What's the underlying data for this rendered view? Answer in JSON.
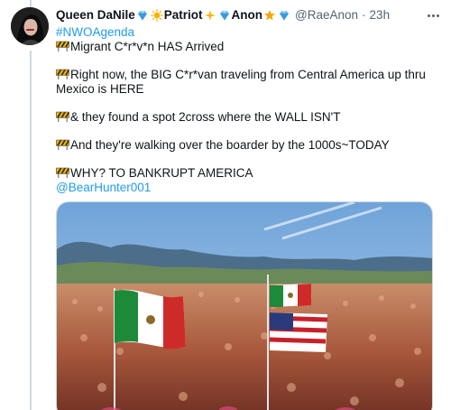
{
  "tweet": {
    "author_name": "Queen DaNile",
    "author_badge_text": "Patriot",
    "author_badge_text2": "Anon",
    "handle": "@RaeAnon",
    "separator": "·",
    "timestamp": "23h",
    "hashtag": "#NWOAgenda",
    "lines": [
      "Migrant C*r*v*n HAS Arrived",
      "Right now, the BIG C*r*van traveling from Central America up thru Mexico is HERE",
      "& they found a spot 2cross where the WALL ISN'T",
      "And they're walking over the boarder by the 1000s~TODAY",
      "WHY? TO BANKRUPT AMERICA"
    ],
    "mention": "@BearHunter001"
  },
  "icons": {
    "avatar": "profile-photo",
    "gem": "gem-emoji",
    "sun": "sun-emoji",
    "sparkles": "sparkles-emoji",
    "star": "glowing-star-emoji",
    "construction": "construction-sign-emoji",
    "more": "ellipsis-icon"
  },
  "colors": {
    "link": "#1d9bf0",
    "secondary_text": "#536471",
    "thread_line": "#cfd9de"
  }
}
